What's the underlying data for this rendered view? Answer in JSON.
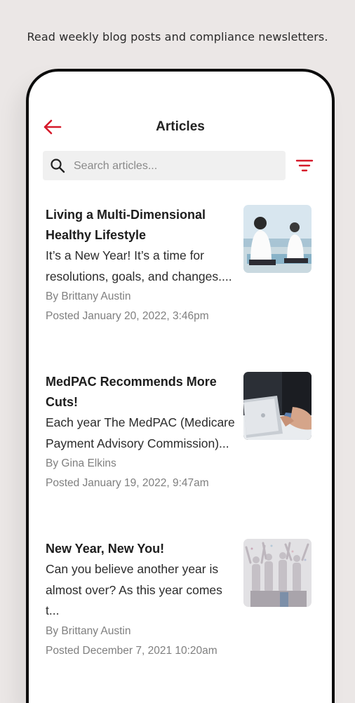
{
  "promo_caption": "Read weekly blog posts and compliance newsletters.",
  "header": {
    "title": "Articles",
    "back_icon": "arrow-left-icon",
    "accent": "#d61a2b"
  },
  "search": {
    "placeholder": "Search articles...",
    "value": ""
  },
  "articles": [
    {
      "title": "Living a Multi-Dimensional Healthy Lifestyle",
      "excerpt": "It’s a New Year! It’s a time for resolutions, goals, and changes....",
      "author": "By Brittany Austin",
      "posted": "Posted January 20, 2022, 3:46pm",
      "thumb": "two-people-sitting-beach-photo"
    },
    {
      "title": "MedPAC Recommends More Cuts!",
      "excerpt": "Each year The MedPAC (Medicare Payment Advisory Commission)...",
      "author": "By Gina Elkins",
      "posted": "Posted January 19, 2022, 9:47am",
      "thumb": "laptop-credit-card-photo"
    },
    {
      "title": "New Year, New You!",
      "excerpt": "Can you believe another year is almost over? As this year comes t...",
      "author": "By Brittany Austin",
      "posted": "Posted December 7, 2021 10:20am",
      "thumb": "celebrating-seniors-photo"
    }
  ]
}
